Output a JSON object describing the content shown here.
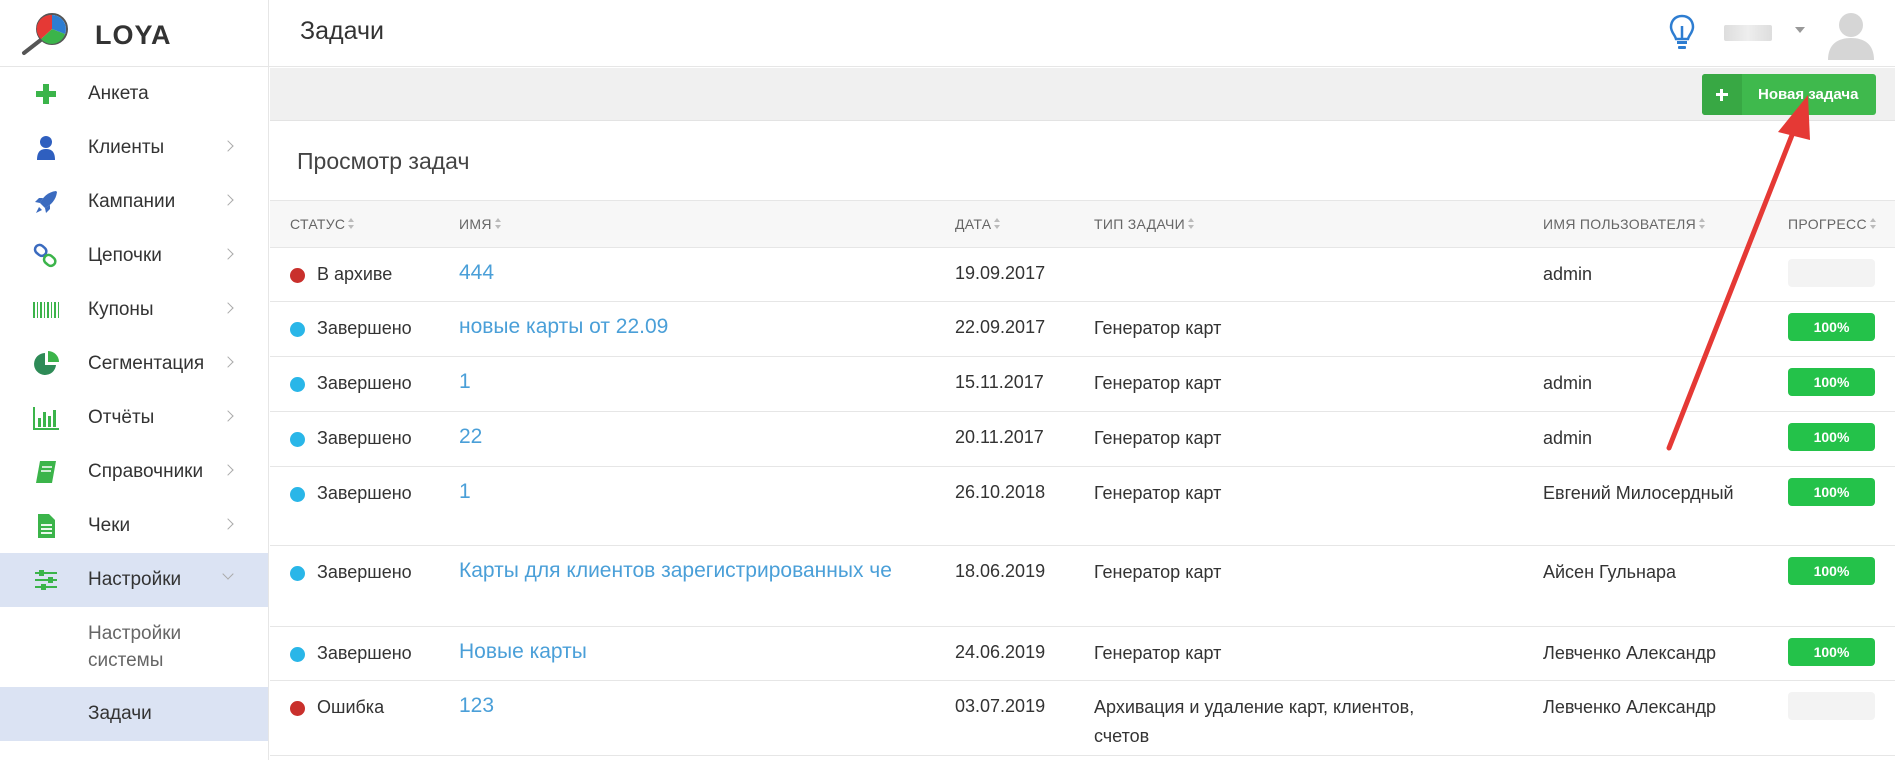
{
  "app": {
    "name": "LOYA"
  },
  "header": {
    "title": "Задачи"
  },
  "sidebar": {
    "items": [
      {
        "label": "Анкета",
        "icon": "plus-icon"
      },
      {
        "label": "Клиенты",
        "icon": "user-icon"
      },
      {
        "label": "Кампании",
        "icon": "rocket-icon"
      },
      {
        "label": "Цепочки",
        "icon": "chain-icon"
      },
      {
        "label": "Купоны",
        "icon": "barcode-icon"
      },
      {
        "label": "Сегментация",
        "icon": "pie-icon"
      },
      {
        "label": "Отчёты",
        "icon": "bar-chart-icon"
      },
      {
        "label": "Справочники",
        "icon": "book-icon"
      },
      {
        "label": "Чеки",
        "icon": "receipt-icon"
      },
      {
        "label": "Настройки",
        "icon": "sliders-icon"
      }
    ],
    "subitems": [
      {
        "label": "Настройки системы"
      },
      {
        "label": "Задачи"
      }
    ]
  },
  "toolbar": {
    "new_task_label": "Новая задача"
  },
  "panel": {
    "title": "Просмотр задач"
  },
  "table": {
    "columns": [
      "Статус",
      "Имя",
      "Дата",
      "Тип задачи",
      "Имя пользователя",
      "Прогресс"
    ],
    "rows": [
      {
        "status": "В архиве",
        "status_color": "#c9302c",
        "name": "444",
        "date": "19.09.2017",
        "type": "",
        "user": "admin",
        "progress": 0,
        "progress_text": "0"
      },
      {
        "status": "Завершено",
        "status_color": "#29b6e8",
        "name": "новые карты от 22.09",
        "date": "22.09.2017",
        "type": "Генератор карт",
        "user": "",
        "progress": 100,
        "progress_text": "100%"
      },
      {
        "status": "Завершено",
        "status_color": "#29b6e8",
        "name": "1",
        "date": "15.11.2017",
        "type": "Генератор карт",
        "user": "admin",
        "progress": 100,
        "progress_text": "100%"
      },
      {
        "status": "Завершено",
        "status_color": "#29b6e8",
        "name": "22",
        "date": "20.11.2017",
        "type": "Генератор карт",
        "user": "admin",
        "progress": 100,
        "progress_text": "100%"
      },
      {
        "status": "Завершено",
        "status_color": "#29b6e8",
        "name": "1",
        "date": "26.10.2018",
        "type": "Генератор карт",
        "user": "Евгений Милосердный",
        "progress": 100,
        "progress_text": "100%"
      },
      {
        "status": "Завершено",
        "status_color": "#29b6e8",
        "name": "Карты для клиентов зарегистрированных че",
        "date": "18.06.2019",
        "type": "Генератор карт",
        "user": "Айсен Гульнара",
        "progress": 100,
        "progress_text": "100%"
      },
      {
        "status": "Завершено",
        "status_color": "#29b6e8",
        "name": "Новые карты",
        "date": "24.06.2019",
        "type": "Генератор карт",
        "user": "Левченко Александр",
        "progress": 100,
        "progress_text": "100%"
      },
      {
        "status": "Ошибка",
        "status_color": "#c9302c",
        "name": "123",
        "date": "03.07.2019",
        "type": "Архивация и удаление карт, клиентов, счетов",
        "user": "Левченко Александр",
        "progress": 0,
        "progress_text": "0"
      }
    ]
  },
  "colors": {
    "accent": "#3fb94d",
    "link": "#4a9fd8",
    "active_nav": "#dbe3f3",
    "annotation": "#e53935"
  }
}
